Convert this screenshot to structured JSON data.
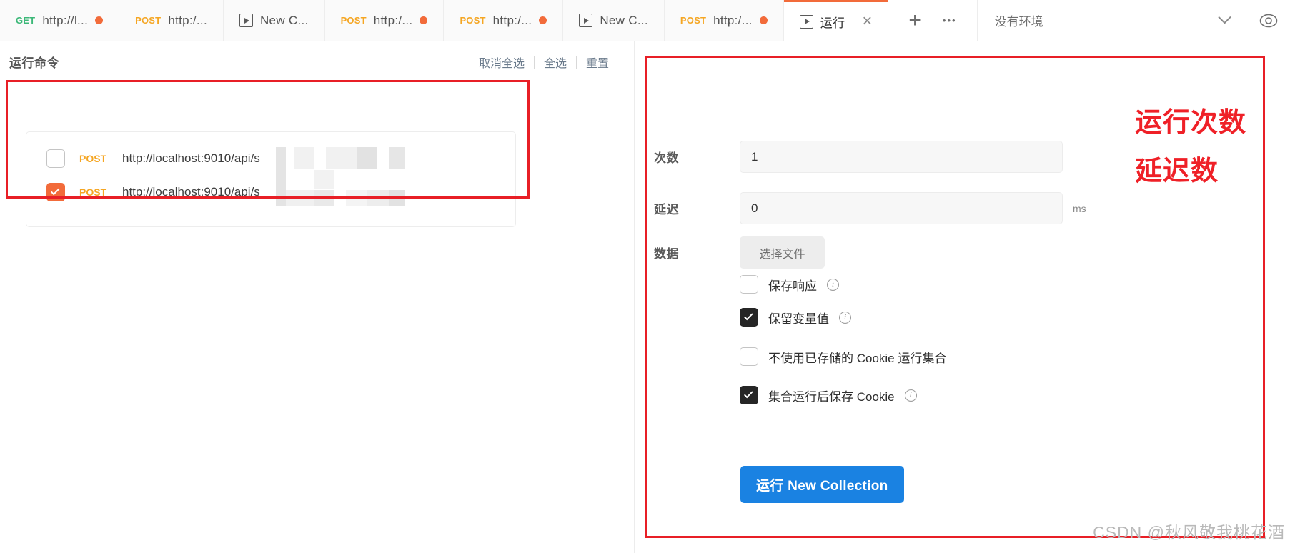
{
  "tabs": [
    {
      "method": "GET",
      "label": "http://l...",
      "icon": "",
      "dirty": true,
      "active": false
    },
    {
      "method": "POST",
      "label": "http:/...",
      "icon": "",
      "dirty": false,
      "active": false
    },
    {
      "method": "",
      "label": "New C...",
      "icon": "run-icon",
      "dirty": false,
      "active": false
    },
    {
      "method": "POST",
      "label": "http:/...",
      "icon": "",
      "dirty": true,
      "active": false
    },
    {
      "method": "POST",
      "label": "http:/...",
      "icon": "",
      "dirty": true,
      "active": false
    },
    {
      "method": "",
      "label": "New C...",
      "icon": "run-icon",
      "dirty": false,
      "active": false
    },
    {
      "method": "POST",
      "label": "http:/...",
      "icon": "",
      "dirty": true,
      "active": false
    },
    {
      "method": "",
      "label": "运行",
      "icon": "run-icon",
      "dirty": false,
      "active": true
    }
  ],
  "tabbar": {
    "close_label": "×",
    "new_tab_label": "+",
    "more_label": "•••"
  },
  "environment": {
    "selected": "没有环境",
    "caret": "chevron-down-icon",
    "eye": "eye-icon"
  },
  "left_panel": {
    "title": "运行命令",
    "actions": [
      {
        "label": "取消全选"
      },
      {
        "label": "全选"
      },
      {
        "label": "重置"
      }
    ],
    "requests": [
      {
        "method": "POST",
        "url": "http://localhost:9010/api/s",
        "checked": false
      },
      {
        "method": "POST",
        "url": "http://localhost:9010/api/s",
        "checked": true
      }
    ]
  },
  "right_panel": {
    "fields": [
      {
        "label": "次数",
        "value": "1",
        "unit": ""
      },
      {
        "label": "延迟",
        "value": "0",
        "unit": "ms"
      }
    ],
    "data_label": "数据",
    "file_button": "选择文件",
    "options": [
      {
        "label": "保存响应",
        "checked": false,
        "info": true
      },
      {
        "label": "保留变量值",
        "checked": true,
        "info": true
      },
      {
        "label": "不使用已存储的 Cookie 运行集合",
        "checked": false,
        "info": false
      },
      {
        "label": "集合运行后保存 Cookie",
        "checked": true,
        "info": true
      }
    ],
    "run_button": "运行 New Collection"
  },
  "annotations": [
    {
      "text": "运行次数"
    },
    {
      "text": "延迟数"
    }
  ],
  "watermark": "CSDN @秋风敬我桃花酒",
  "colors": {
    "accent_orange": "#f26b3a",
    "method_post": "#f5a623",
    "method_get": "#3cb878",
    "primary_blue": "#1a82e2",
    "annotation_red": "#e81f26"
  }
}
